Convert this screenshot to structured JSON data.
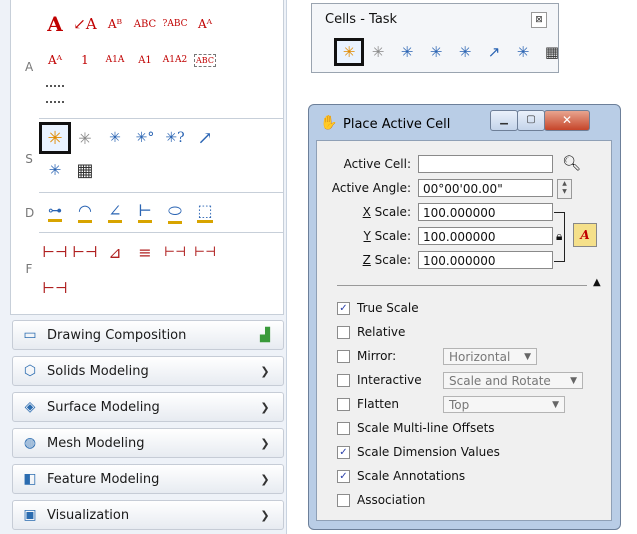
{
  "task_panel": {
    "groups": [
      {
        "letter": "A",
        "tools": [
          "A",
          "↙A",
          "Aᴮ",
          "ABC",
          "?ABC",
          "Aᴬ",
          "Aᴬ",
          "1",
          "A1A",
          "A1",
          "A1A2",
          "ABC"
        ]
      },
      {
        "letter": "S",
        "tools": [
          "✳",
          "✳",
          "✳",
          "✳°",
          "✳?",
          "↗",
          "✳",
          "▦"
        ]
      },
      {
        "letter": "D",
        "tools": [
          "⊶",
          "◠",
          "∠",
          "⊢",
          "⬭",
          "⬚"
        ]
      },
      {
        "letter": "F",
        "tools": [
          "⊢⊣",
          "⊢⊣",
          "⊿",
          "≡",
          "⊢⊣",
          "⊢⊣",
          "⊢⊣"
        ]
      }
    ],
    "favorites": [
      {
        "label": "Drawing Composition",
        "icon": "drawing-composition-icon",
        "expanded": false
      },
      {
        "label": "Solids Modeling",
        "icon": "solids-icon",
        "expanded": false
      },
      {
        "label": "Surface Modeling",
        "icon": "surface-icon",
        "expanded": false
      },
      {
        "label": "Mesh Modeling",
        "icon": "mesh-icon",
        "expanded": false
      },
      {
        "label": "Feature Modeling",
        "icon": "feature-icon",
        "expanded": false
      },
      {
        "label": "Visualization",
        "icon": "visualization-icon",
        "expanded": false
      }
    ]
  },
  "cells_task": {
    "title": "Cells - Task",
    "close_label": "⊠"
  },
  "dialog": {
    "title": "Place Active Cell",
    "active_cell_label": "Active Cell:",
    "active_cell_value": "",
    "active_angle_label": "Active Angle:",
    "active_angle_value": "00°00'00.00\"",
    "x_scale_label": "X Scale:",
    "x_scale_value": "100.000000",
    "y_scale_label": "Y Scale:",
    "y_scale_value": "100.000000",
    "z_scale_label": "Z Scale:",
    "z_scale_value": "100.000000",
    "options": [
      {
        "label": "True Scale",
        "checked": true
      },
      {
        "label": "Relative",
        "checked": false
      },
      {
        "label": "Mirror:",
        "checked": false,
        "select": "Horizontal"
      },
      {
        "label": "Interactive",
        "checked": false,
        "select": "Scale and Rotate"
      },
      {
        "label": "Flatten",
        "checked": false,
        "select": "Top"
      },
      {
        "label": "Scale Multi-line Offsets",
        "checked": false
      },
      {
        "label": "Scale Dimension Values",
        "checked": true
      },
      {
        "label": "Scale Annotations",
        "checked": true
      },
      {
        "label": "Association",
        "checked": false
      }
    ]
  },
  "colors": {
    "selected_outline": "#111111",
    "dialog_frame": "#b9cde6",
    "text_tool_red": "#c00000"
  }
}
